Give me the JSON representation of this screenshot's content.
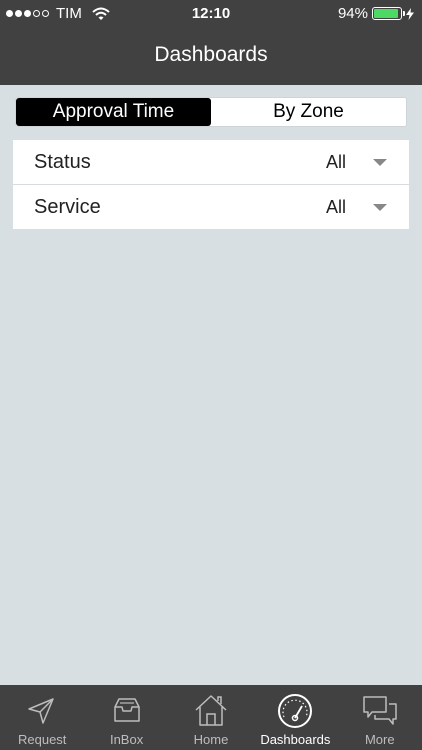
{
  "status_bar": {
    "carrier": "TIM",
    "time": "12:10",
    "battery_percent_text": "94%",
    "battery_level": 0.94,
    "battery_color": "#4cd964",
    "signal_bars_filled": 3,
    "signal_bars_total": 5,
    "icons": [
      "wifi-icon",
      "battery-icon",
      "charging-bolt-icon"
    ]
  },
  "nav": {
    "title": "Dashboards"
  },
  "segments": [
    {
      "label": "Approval Time",
      "active": true
    },
    {
      "label": "By Zone",
      "active": false
    }
  ],
  "filters": [
    {
      "label": "Status",
      "value": "All"
    },
    {
      "label": "Service",
      "value": "All"
    }
  ],
  "tabbar": {
    "items": [
      {
        "label": "Request",
        "icon": "paper-plane-icon",
        "active": false
      },
      {
        "label": "InBox",
        "icon": "inbox-tray-icon",
        "active": false
      },
      {
        "label": "Home",
        "icon": "house-icon",
        "active": false
      },
      {
        "label": "Dashboards",
        "icon": "speedometer-icon",
        "active": true
      },
      {
        "label": "More",
        "icon": "chat-bubbles-icon",
        "active": false
      }
    ]
  },
  "colors": {
    "header_bg": "#414141",
    "page_bg": "#d8dfe3",
    "segment_active_bg": "#000000",
    "tab_inactive_text": "#bdbdbd"
  }
}
